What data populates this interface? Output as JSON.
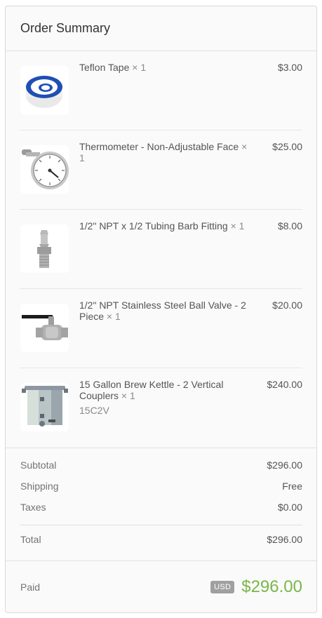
{
  "summary": {
    "title": "Order Summary",
    "items": [
      {
        "name": "Teflon Tape",
        "qty": "× 1",
        "price": "$3.00",
        "sku": "",
        "icon": "teflon-tape-image"
      },
      {
        "name": "Thermometer - Non-Adjustable Face",
        "qty": "× 1",
        "price": "$25.00",
        "sku": "",
        "icon": "thermometer-image"
      },
      {
        "name": "1/2\" NPT x 1/2 Tubing Barb Fitting",
        "qty": "× 1",
        "price": "$8.00",
        "sku": "",
        "icon": "barb-fitting-image"
      },
      {
        "name": "1/2\" NPT Stainless Steel Ball Valve - 2 Piece",
        "qty": "× 1",
        "price": "$20.00",
        "sku": "",
        "icon": "ball-valve-image"
      },
      {
        "name": "15 Gallon Brew Kettle - 2 Vertical Couplers",
        "qty": "× 1",
        "price": "$240.00",
        "sku": "15C2V",
        "icon": "brew-kettle-image"
      }
    ],
    "subtotal_label": "Subtotal",
    "subtotal_value": "$296.00",
    "shipping_label": "Shipping",
    "shipping_value": "Free",
    "taxes_label": "Taxes",
    "taxes_value": "$0.00",
    "total_label": "Total",
    "total_value": "$296.00",
    "paid_label": "Paid",
    "paid_currency": "USD",
    "paid_value": "$296.00",
    "colors": {
      "accent": "#7ab648",
      "badge": "#a0a0a0"
    }
  }
}
